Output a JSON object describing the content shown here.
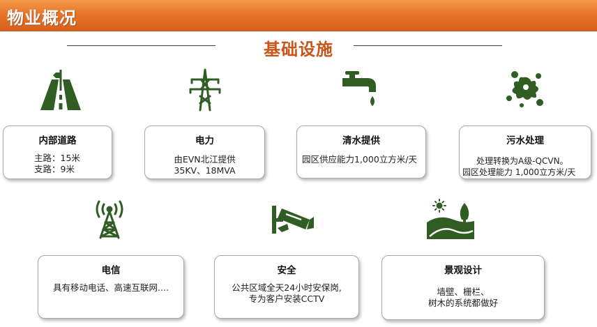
{
  "header": {
    "title": "物业概况"
  },
  "section": {
    "title": "基础设施"
  },
  "colors": {
    "accent": "#c8561a",
    "icon": "#2f5d24",
    "header": "#e8742a"
  },
  "facilities": [
    {
      "id": "roads",
      "icon": "road-icon",
      "title": "内部道路",
      "lines": [
        "主路：15米",
        "支路：9米"
      ]
    },
    {
      "id": "power",
      "icon": "power-tower-icon",
      "title": "电力",
      "lines": [
        "由EVN北江提供",
        "35KV、18MVA"
      ]
    },
    {
      "id": "water",
      "icon": "water-tap-icon",
      "title": "清水提供",
      "lines": [
        "园区供应能力1,000立方米/天"
      ]
    },
    {
      "id": "sewage",
      "icon": "sewage-splash-icon",
      "title": "污水处理",
      "lines": [
        "处理转换为A级-QCVN。",
        "园区处理能力 1,000立方米/天"
      ]
    },
    {
      "id": "telecom",
      "icon": "telecom-tower-icon",
      "title": "电信",
      "lines": [
        "具有移动电话、高速互联网...."
      ]
    },
    {
      "id": "security",
      "icon": "cctv-camera-icon",
      "title": "安全",
      "lines": [
        "公共区域全天24小时安保岗,",
        "专为客户安装CCTV"
      ]
    },
    {
      "id": "landscape",
      "icon": "landscape-icon",
      "title": "景观设计",
      "lines": [
        "墙壁、栅栏、",
        "树木的系统都做好"
      ]
    }
  ]
}
